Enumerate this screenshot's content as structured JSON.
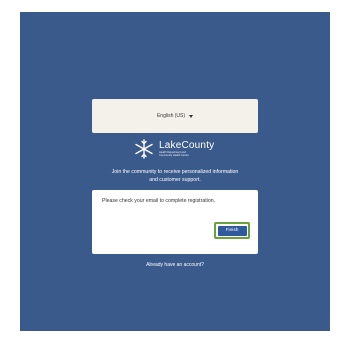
{
  "language": {
    "selected": "English (US)"
  },
  "logo": {
    "name": "LakeCounty",
    "subtitle_line1": "Health Department and",
    "subtitle_line2": "Community Health Center"
  },
  "intro": {
    "line1": "Join the community to receive personalized information",
    "line2": "and customer support."
  },
  "card": {
    "message": "Please check your email to complete registration.",
    "finish_label": "Finish"
  },
  "footer": {
    "signin_link": "Already have an account?"
  },
  "colors": {
    "background": "#3b5a8c",
    "button": "#2f5b9c",
    "highlight": "#6aa23c"
  }
}
